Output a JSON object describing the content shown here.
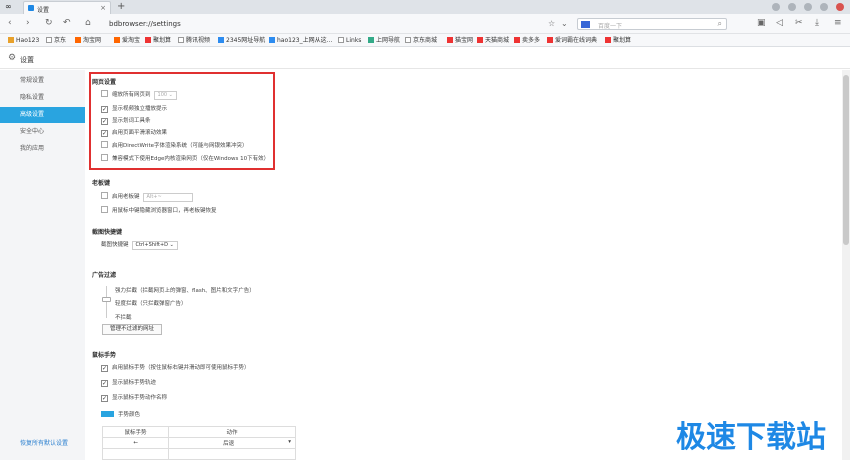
{
  "window": {
    "tab_title": "设置",
    "new_tab": "+",
    "url": "bdbrowser://settings",
    "search_placeholder": "百度一下"
  },
  "bookmarks": [
    "Hao123",
    "京东",
    "淘宝网",
    "爱淘宝",
    "聚划算",
    "腾讯视频",
    "2345网址导航",
    "hao123_上网从这...",
    "Links",
    "上网导航",
    "京东商城",
    "猫宝网",
    "天猫商城",
    "卖多多",
    "爱词霸在线词典",
    "聚划算"
  ],
  "header": {
    "title": "设置"
  },
  "sidebar": {
    "items": [
      "常规设置",
      "隐私设置",
      "高级设置",
      "安全中心",
      "我的应用"
    ],
    "active_index": 2,
    "restore_link": "恢复所有默认设置"
  },
  "sections": {
    "web": {
      "title": "网页设置",
      "zoom_label": "缩放所有网页到",
      "zoom_value": "100",
      "options": [
        {
          "label": "显示视频独立播放提示",
          "checked": true
        },
        {
          "label": "显示划词工具条",
          "checked": true
        },
        {
          "label": "启用页面平滑滚动效果",
          "checked": true
        },
        {
          "label": "启用DirectWrite字体渲染系统（可能与网银效果冲突）",
          "checked": false
        },
        {
          "label": "兼容模式下使用Edge内核渲染网页（仅在Windows 10下有效）",
          "checked": false
        }
      ]
    },
    "boss": {
      "title": "老板键",
      "enable_label": "启用老板键",
      "key_value": "Alt+~",
      "middle_click_label": "用鼠标中键隐藏浏览器窗口，再老板键恢复"
    },
    "screenshot": {
      "title": "截图快捷键",
      "label": "截图快捷键",
      "value": "Ctrl+Shift+D"
    },
    "adblock": {
      "title": "广告过滤",
      "levels": [
        "强力拦截（拦截网页上的弹窗、flash、图片和文字广告）",
        "轻度拦截（只拦截弹窗广告）",
        "不拦截"
      ],
      "manage_button": "管理不过滤的网址"
    },
    "gesture": {
      "title": "鼠标手势",
      "options": [
        {
          "label": "启用鼠标手势（按住鼠标右键并滑动即可使用鼠标手势）",
          "checked": true
        },
        {
          "label": "显示鼠标手势轨迹",
          "checked": true
        },
        {
          "label": "显示鼠标手势动作名称",
          "checked": true
        }
      ],
      "color_label": "手势颜色",
      "color": "#29a4e0",
      "table_headers": [
        "鼠标手势",
        "动作"
      ],
      "table_rows": [
        {
          "gesture": "←",
          "action": "后退"
        }
      ]
    }
  },
  "watermark": "极速下载站"
}
